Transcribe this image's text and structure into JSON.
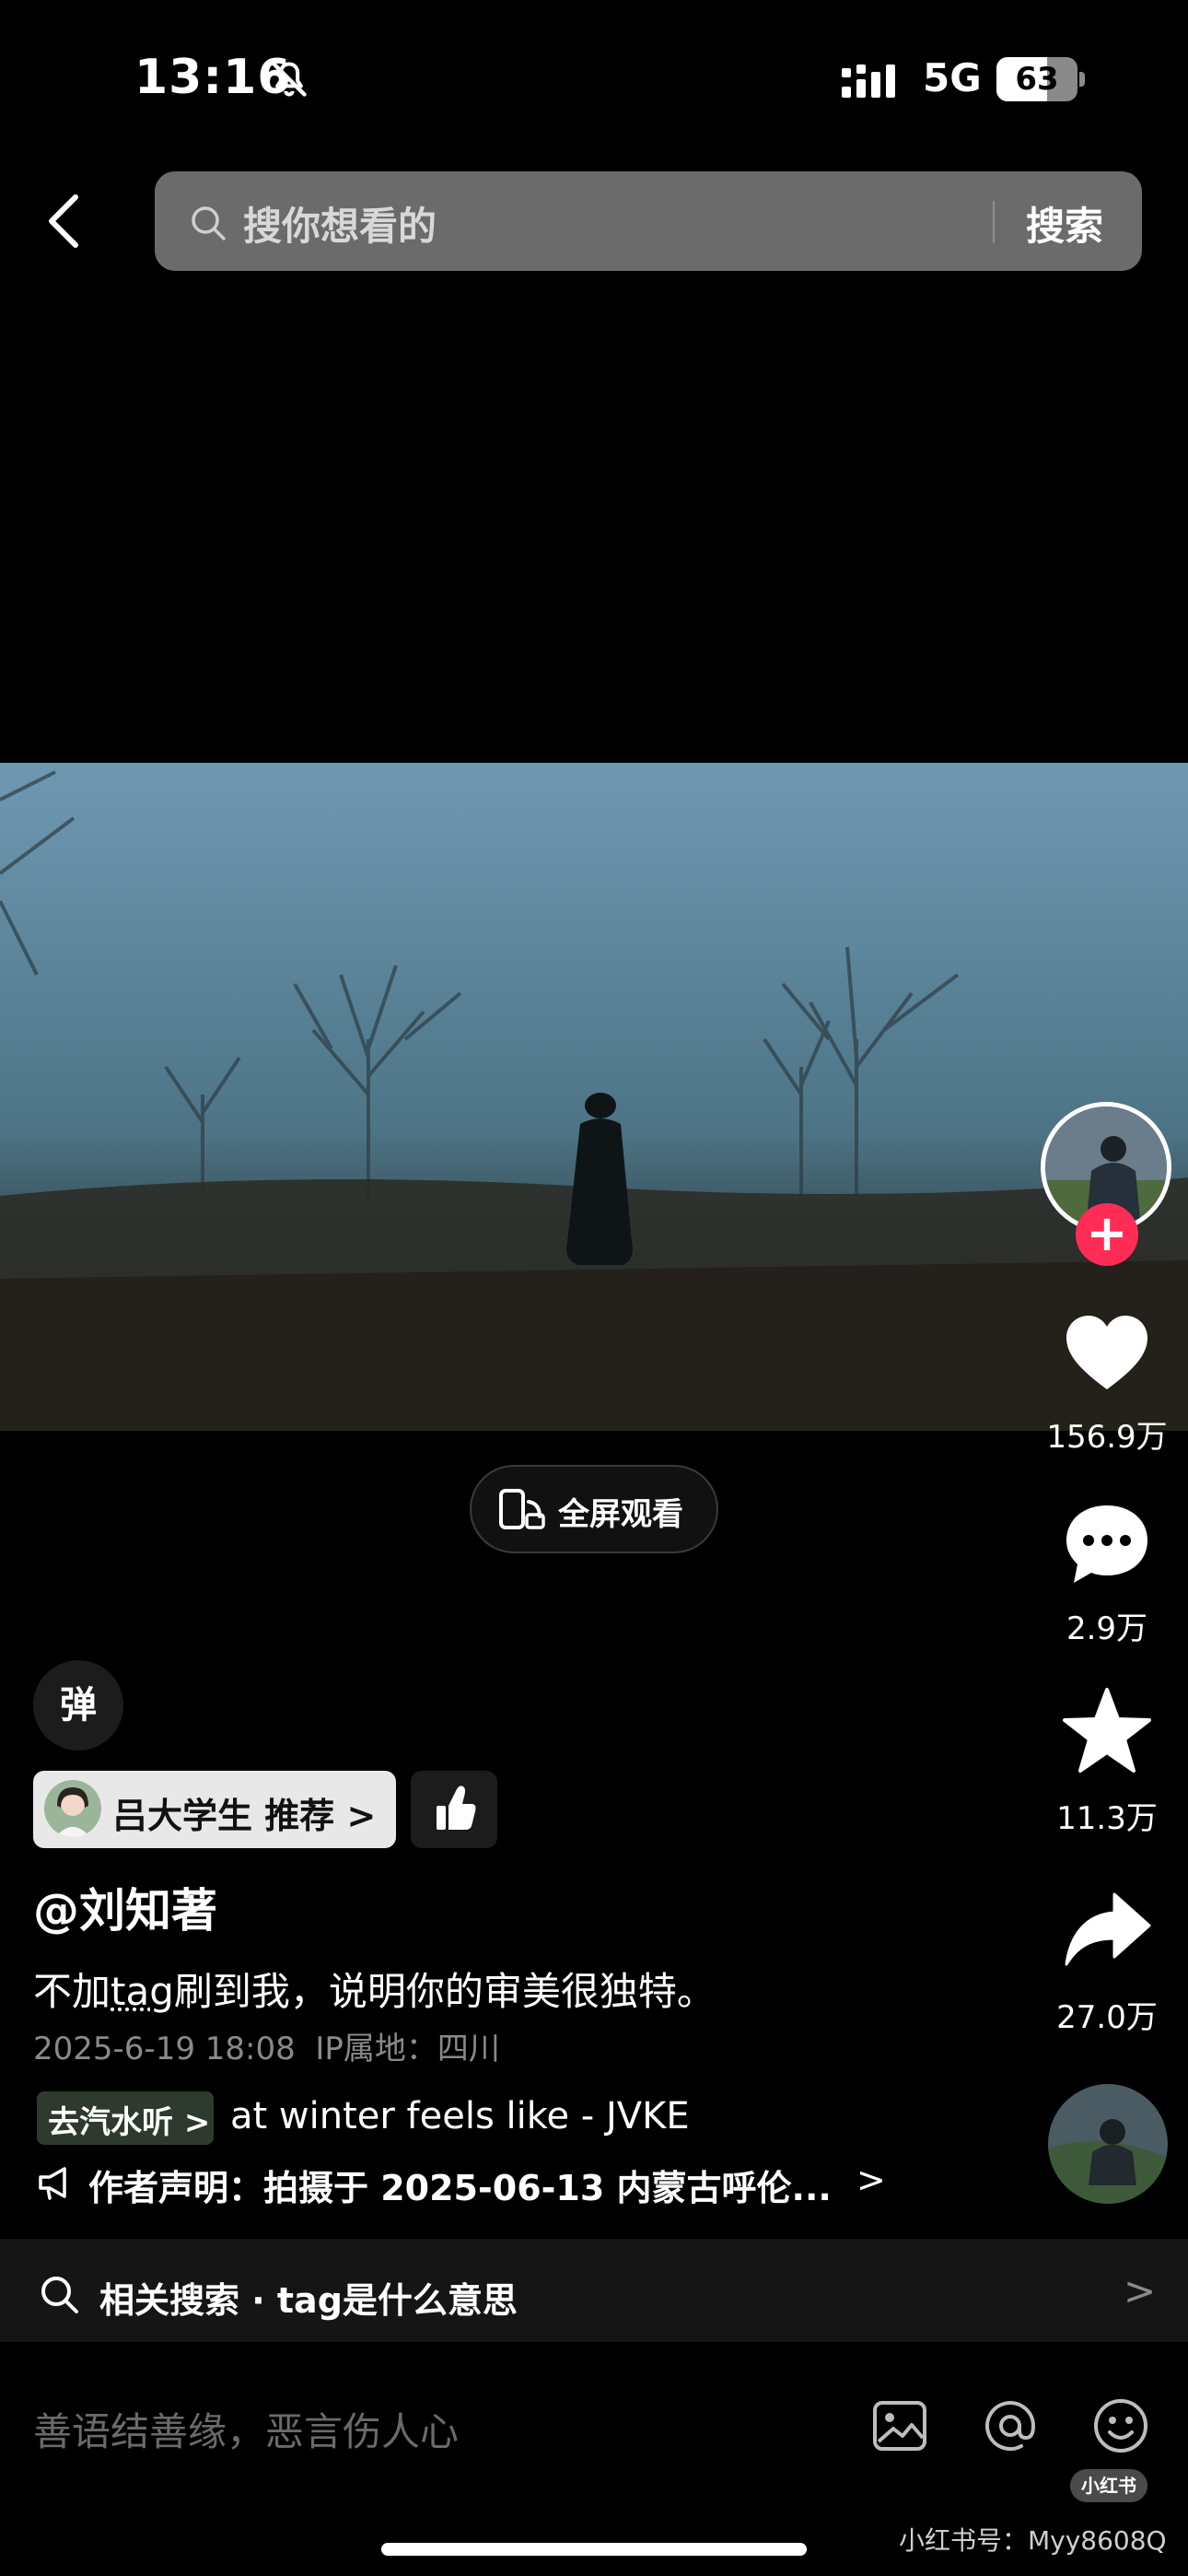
{
  "status_bar": {
    "time": "13:16",
    "network": "5G",
    "battery": "63",
    "battery_level": 0.63
  },
  "search": {
    "placeholder": "搜你想看的",
    "button_label": "搜索"
  },
  "video": {
    "fullscreen_label": "全屏观看"
  },
  "actions": {
    "likes": "156.9万",
    "comments": "2.9万",
    "favorites": "11.3万",
    "shares": "27.0万"
  },
  "danmaku_label": "弹",
  "recommender": {
    "text": "吕大学生  推荐 >"
  },
  "post": {
    "author": "@刘知著",
    "description_before": "不加",
    "description_tag": "tag",
    "description_after": "刷到我，说明你的审美很独特。",
    "date": "2025-6-19 18:08",
    "ip_location": "IP属地：四川"
  },
  "music": {
    "chip_label": "去汽水听 >",
    "title": "at winter feels like - JVKE"
  },
  "declaration": {
    "text": "作者声明：拍摄于 2025-06-13 内蒙古呼伦...",
    "arrow": ">"
  },
  "related_search": {
    "text": "相关搜索 · tag是什么意思",
    "arrow": ">"
  },
  "comment": {
    "placeholder": "善语结善缘，恶言伤人心"
  },
  "branding": {
    "badge": "小红书",
    "watermark": "小红书号：Myy8608Q"
  },
  "colors": {
    "accent": "#ff2d55",
    "search_bg": "#6b6b6b"
  },
  "icons": [
    "bell-off-icon",
    "signal-icon",
    "back-icon",
    "search-icon",
    "fullscreen-icon",
    "heart-icon",
    "comment-icon",
    "star-icon",
    "share-icon",
    "thumbs-up-icon",
    "megaphone-icon",
    "image-icon",
    "at-icon",
    "emoji-icon"
  ]
}
